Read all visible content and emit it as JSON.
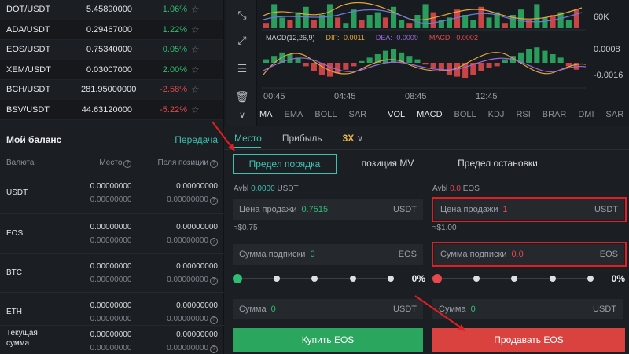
{
  "tickers": [
    {
      "pair": "DOT/USDT",
      "price": "5.45890000",
      "change": "1.06%",
      "dir": "up"
    },
    {
      "pair": "ADA/USDT",
      "price": "0.29467000",
      "change": "1.22%",
      "dir": "up"
    },
    {
      "pair": "EOS/USDT",
      "price": "0.75340000",
      "change": "0.05%",
      "dir": "up"
    },
    {
      "pair": "XEM/USDT",
      "price": "0.03007000",
      "change": "2.00%",
      "dir": "up"
    },
    {
      "pair": "BCH/USDT",
      "price": "281.95000000",
      "change": "-2.58%",
      "dir": "down"
    },
    {
      "pair": "BSV/USDT",
      "price": "44.63120000",
      "change": "-5.22%",
      "dir": "down"
    }
  ],
  "balance": {
    "title": "Мой баланс",
    "transfer": "Передача",
    "col_currency": "Валюта",
    "col_spot": "Место",
    "col_position": "Поля позиции",
    "rows": [
      {
        "currency": "USDT",
        "a1": "0.00000000",
        "a2": "0.00000000",
        "b1": "0.00000000",
        "b2": "0.00000000"
      },
      {
        "currency": "EOS",
        "a1": "0.00000000",
        "a2": "0.00000000",
        "b1": "0.00000000",
        "b2": "0.00000000"
      },
      {
        "currency": "BTC",
        "a1": "0.00000000",
        "a2": "0.00000000",
        "b1": "0.00000000",
        "b2": "0.00000000"
      },
      {
        "currency": "ETH",
        "a1": "0.00000000",
        "a2": "0.00000000",
        "b1": "0.00000000",
        "b2": "0.00000000"
      },
      {
        "currency": "Текущая сумма",
        "a1": "0.00000000",
        "a2": "0.00000000",
        "b1": "0.00000000",
        "b2": "0.00000000"
      }
    ]
  },
  "chart": {
    "axis_top": "60K",
    "axis_mid": "0.0008",
    "axis_low": "-0.0016",
    "macd_label": "MACD(12,26,9)",
    "dif": "DIF: -0.0011",
    "dea": "DEA: -0.0009",
    "macd": "MACD: -0.0002",
    "times": [
      "00:45",
      "04:45",
      "08:45",
      "12:45"
    ],
    "indicators_left": [
      "MA",
      "EMA",
      "BOLL",
      "SAR"
    ],
    "indicators_right": [
      "VOL",
      "MACD",
      "BOLL",
      "KDJ",
      "RSI",
      "BRAR",
      "DMI",
      "SAR"
    ],
    "volume_bars": [
      0.2,
      0.9,
      0.4,
      0.3,
      0.6,
      0.8,
      0.3,
      0.5,
      0.9,
      0.4,
      0.2,
      0.7,
      0.3,
      0.5,
      0.6,
      0.4,
      0.8,
      0.3,
      0.2,
      0.5,
      0.9,
      0.6,
      0.3,
      0.4,
      0.7,
      0.5,
      0.3,
      0.8,
      0.4,
      0.6,
      0.2,
      0.5,
      0.7,
      0.3,
      0.9,
      0.4,
      0.5,
      0.6,
      0.3,
      0.7
    ],
    "macd_hist": [
      0.2,
      0.4,
      0.6,
      0.5,
      0.3,
      -0.2,
      -0.5,
      -0.7,
      -0.8,
      -0.6,
      -0.4,
      -0.2,
      0.1,
      0.3,
      0.5,
      0.7,
      0.8,
      0.6,
      0.4,
      0.2,
      -0.1,
      -0.3,
      -0.5,
      -0.7,
      -0.8,
      -0.9,
      -0.7,
      -0.5,
      -0.3,
      -0.2,
      0.2,
      0.4,
      0.6,
      0.8,
      0.9,
      0.7,
      0.5,
      0.3,
      -0.2,
      -0.4
    ]
  },
  "trade": {
    "tab_spot": "Место",
    "tab_profit": "Прибыль",
    "leverage": "3X",
    "type_limit": "Предел порядка",
    "type_market": "позиция MV",
    "type_stop": "Предел остановки",
    "buy": {
      "avbl_label": "Avbl",
      "avbl_value": "0.0000",
      "avbl_unit": "USDT",
      "price_label": "Цена продажи",
      "price_value": "0.7515",
      "price_unit": "USDT",
      "approx": "≈$0.75",
      "amount_label": "Сумма подписки",
      "amount_value": "0",
      "amount_unit": "EOS",
      "percent": "0%",
      "total_label": "Сумма",
      "total_value": "0",
      "total_unit": "USDT",
      "button": "Купить EOS"
    },
    "sell": {
      "avbl_label": "Avbl",
      "avbl_value": "0.0",
      "avbl_unit": "EOS",
      "price_label": "Цена продажи",
      "price_value": "1",
      "price_unit": "USDT",
      "approx": "≈$1.00",
      "amount_label": "Сумма подписки",
      "amount_value": "0.0",
      "amount_unit": "EOS",
      "percent": "0%",
      "total_label": "Сумма",
      "total_value": "0",
      "total_unit": "USDT",
      "button": "Продавать EOS"
    }
  },
  "colors": {
    "accent": "#3ec1b0",
    "up": "#2fbd72",
    "down": "#e5484d",
    "buy": "#2aa65e",
    "sell": "#d9423f",
    "highlight": "#e01f25"
  }
}
